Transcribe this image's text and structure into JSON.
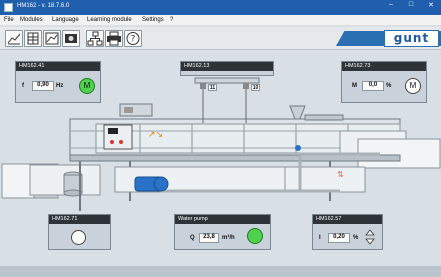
{
  "window": {
    "title": "HM162 - v. 18.7.6.0",
    "min": "–",
    "max": "□",
    "close": "✕"
  },
  "menu": [
    "File",
    "Modules",
    "Language",
    "Learning module",
    "Settings",
    "?"
  ],
  "toolbar": {
    "icons": [
      "chart-icon",
      "table-icon",
      "graph-icon",
      "camera-icon",
      "network-icon",
      "printer-icon",
      "help-icon"
    ]
  },
  "logo": "gunt",
  "panels": {
    "p41": {
      "title": "HM162.41",
      "symbol": "f",
      "value": "0,90",
      "unit": "Hz",
      "badge": "M"
    },
    "p13": {
      "title": "HM162.13",
      "tag1": "11",
      "tag2": "10"
    },
    "p73": {
      "title": "HM162.73",
      "symbol": "M",
      "value": "0,0",
      "unit": "%",
      "badge": "M"
    },
    "p71": {
      "title": "HM162.71"
    },
    "pump": {
      "title": "Water pump",
      "symbol": "Q",
      "value": "23,8",
      "unit": "m³/h"
    },
    "p57": {
      "title": "HM162.57",
      "symbol": "I",
      "value": "0,20",
      "unit": "%"
    }
  },
  "colors": {
    "titlebar": "#1f5fae",
    "accent_green": "#4fd14f",
    "pump_blue": "#2a72c8"
  }
}
